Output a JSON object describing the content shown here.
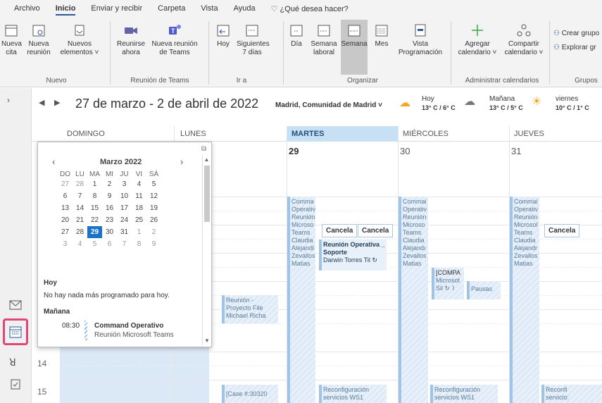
{
  "menu": {
    "items": [
      "Archivo",
      "Inicio",
      "Enviar y recibir",
      "Carpeta",
      "Vista",
      "Ayuda"
    ],
    "active": "Inicio",
    "tell_me": "¿Qué desea hacer?"
  },
  "ribbon": {
    "nueva_cita": [
      "Nueva",
      "cita"
    ],
    "nueva_reunion": [
      "Nueva",
      "reunión"
    ],
    "nuevos_elementos": [
      "Nuevos",
      "elementos ˅"
    ],
    "reunirse": [
      "Reunirse",
      "ahora"
    ],
    "nueva_reunion_teams": [
      "Nueva reunión",
      "de Teams"
    ],
    "hoy": "Hoy",
    "siguientes": [
      "Siguientes",
      "7 días"
    ],
    "dia": "Día",
    "semana_laboral": [
      "Semana",
      "laboral"
    ],
    "semana": "Semana",
    "mes": "Mes",
    "vista_programacion": [
      "Vista",
      "Programación"
    ],
    "agregar": [
      "Agregar",
      "calendario ˅"
    ],
    "compartir": [
      "Compartir",
      "calendario ˅"
    ],
    "crear_grupo": "Crear grupo",
    "explorar": "Explorar gr",
    "groups": {
      "nuevo": "Nuevo",
      "teams": "Reunión de Teams",
      "ira": "Ir a",
      "organizar": "Organizar",
      "administrar": "Administrar calendarios",
      "grupos": "Grupos"
    }
  },
  "header": {
    "range": "27 de marzo - 2 de abril de 2022",
    "location": "Madrid, Comunidad de Madrid",
    "weather": [
      {
        "day": "Hoy",
        "temp": "13° C / 6° C"
      },
      {
        "day": "Mañana",
        "temp": "13° C / 5° C"
      },
      {
        "day": "viernes",
        "temp": "10° C / 1° C"
      }
    ]
  },
  "days": [
    {
      "name": "DOMINGO",
      "date": ""
    },
    {
      "name": "LUNES",
      "date": ""
    },
    {
      "name": "MARTES",
      "date": "29"
    },
    {
      "name": "MIÉRCOLES",
      "date": "30"
    },
    {
      "name": "JUEVES",
      "date": "31"
    }
  ],
  "mini_calendar": {
    "title": "Marzo 2022",
    "weekdays": [
      "DO",
      "LU",
      "MA",
      "MI",
      "JU",
      "VI",
      "SÁ"
    ],
    "weeks": [
      [
        "27",
        "28",
        "1",
        "2",
        "3",
        "4",
        "5"
      ],
      [
        "6",
        "7",
        "8",
        "9",
        "10",
        "11",
        "12"
      ],
      [
        "13",
        "14",
        "15",
        "16",
        "17",
        "18",
        "19"
      ],
      [
        "20",
        "21",
        "22",
        "23",
        "24",
        "25",
        "26"
      ],
      [
        "27",
        "28",
        "29",
        "30",
        "31",
        "1",
        "2"
      ],
      [
        "3",
        "4",
        "5",
        "6",
        "7",
        "8",
        "9"
      ]
    ],
    "selected": "29"
  },
  "agenda": {
    "today_label": "Hoy",
    "today_text": "No hay nada más programado para hoy.",
    "tomorrow_label": "Mañana",
    "item_time": "08:30",
    "item_title": "Command Operativo",
    "item_sub": "Reunión Microsoft Teams"
  },
  "hours": [
    "14",
    "15"
  ],
  "appointments": {
    "cmd_lines": [
      "Comma",
      "Operativ",
      "Reunión",
      "Microso",
      "Teams",
      "Claudia",
      "Alejandi",
      "Zevallos",
      "Matias"
    ],
    "cmd_lines_wed": [
      "Commai",
      "Operativ",
      "Reunión",
      "Microso",
      "Teams",
      "Claudia",
      "Alejandı",
      "Zevallos",
      "Matias"
    ],
    "cmd_lines_thu": [
      "Commai",
      "Operativ",
      "Reunión",
      "Microsol",
      "Teams",
      "Claudia",
      "Alejandr",
      "Zevallos",
      "Matias"
    ],
    "cancela": "Cancela",
    "soporte_title": "Reunión Operativa _ Soporte",
    "soporte_who": "Darwin Torres Til",
    "compa": [
      "[COMPA",
      "Microsot",
      "Sil"
    ],
    "pausas": "Pausas",
    "reunion_file": [
      "Reunión -",
      "Proyecto File",
      "Michael Richa"
    ],
    "case": "[Case #:30320",
    "reconf": [
      "Reconfiguración",
      "servicios WS1"
    ],
    "reconf_thu": [
      "Reconfi",
      "servicio:"
    ]
  }
}
